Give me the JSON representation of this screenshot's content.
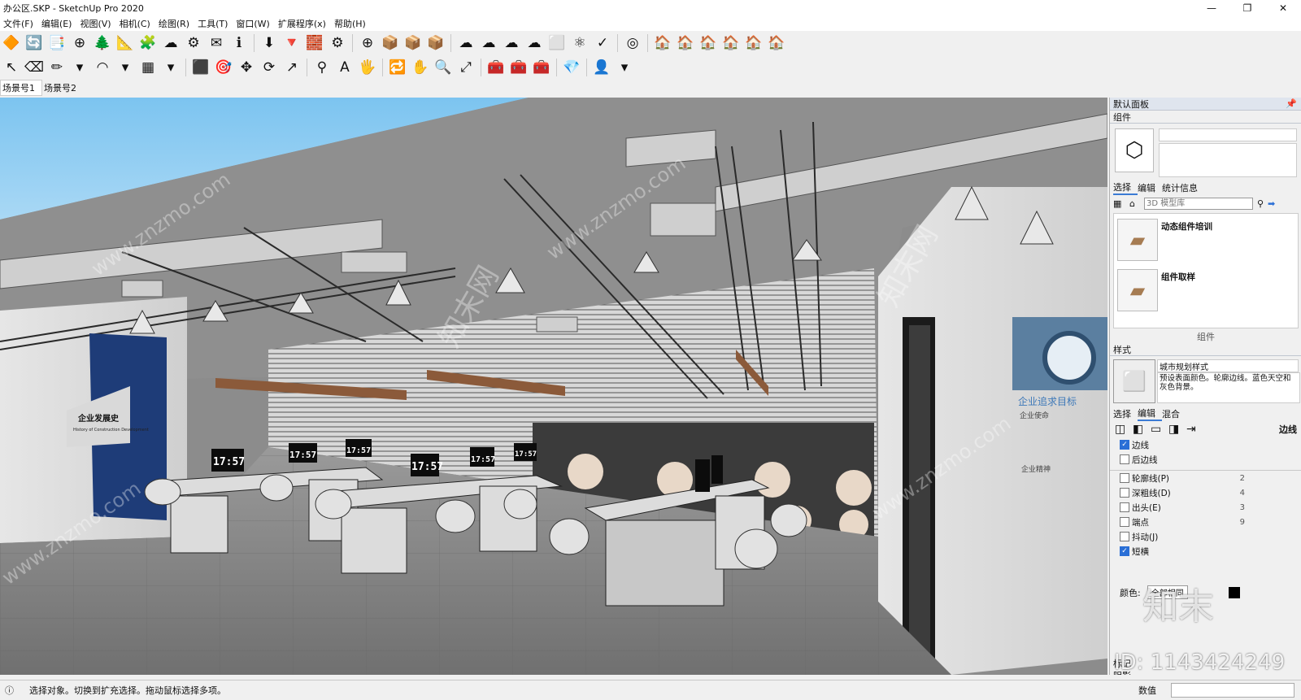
{
  "window": {
    "title": "办公区.SKP - SketchUp Pro 2020",
    "minimize": "—",
    "maximize": "❐",
    "close": "✕"
  },
  "menu": [
    "文件(F)",
    "编辑(E)",
    "视图(V)",
    "相机(C)",
    "绘图(R)",
    "工具(T)",
    "窗口(W)",
    "扩展程序(x)",
    "帮助(H)"
  ],
  "toolbar1": [
    "🔶",
    "🔄",
    "📑",
    "⊕",
    "🌲",
    "📐",
    "🧩",
    "☁",
    "⚙",
    "✉",
    "ℹ",
    "|",
    "⬇",
    "🔻",
    "🧱",
    "⚙",
    "|",
    "⊕",
    "📦",
    "📦",
    "📦",
    "|",
    "☁",
    "☁",
    "☁",
    "☁",
    "⬜",
    "⚛",
    "✓",
    "|",
    "◎",
    "|",
    "🏠",
    "🏠",
    "🏠",
    "🏠",
    "🏠",
    "🏠"
  ],
  "toolbar2": [
    "↖",
    "⌫",
    "✏",
    "▾",
    "◠",
    "▾",
    "▦",
    "▾",
    "|",
    "⬛",
    "🎯",
    "✥",
    "⟳",
    "↗",
    "|",
    "⚲",
    "A",
    "🖐",
    "|",
    "🔁",
    "✋",
    "🔍",
    "⤢",
    "|",
    "🧰",
    "🧰",
    "🧰",
    "|",
    "💎",
    "|",
    "👤",
    "▾"
  ],
  "scenes": [
    "场景号1",
    "场景号2"
  ],
  "viewport": {
    "sign_title": "企业发展史",
    "sign_subtitle": "History of Construction Development",
    "clock": "17:57",
    "right_wall_title": "企业追求目标",
    "right_wall_mission": "企业使命",
    "right_wall_spirit": "企业精神",
    "watermark": "www.znzmo.com",
    "watermark_cn": "知末网",
    "logo": "知末",
    "id_text": "ID: 1143424249"
  },
  "panel": {
    "title": "默认面板",
    "components_header": "组件",
    "comp_tabs": [
      "选择",
      "编辑",
      "统计信息"
    ],
    "search_placeholder": "3D 模型库",
    "items": [
      {
        "name": "动态组件培训"
      },
      {
        "name": "组件取样"
      }
    ],
    "components_footer": "组件",
    "styles_header": "样式",
    "style_name": "城市规划样式",
    "style_desc": "预设表面颜色。轮廓边线。蓝色天空和灰色背景。",
    "style_tabs": [
      "选择",
      "编辑",
      "混合"
    ],
    "edge_label": "边线",
    "edges": [
      {
        "label": "边线",
        "checked": true,
        "value": ""
      },
      {
        "label": "后边线",
        "checked": false,
        "value": ""
      },
      {
        "label": "轮廓线(P)",
        "checked": false,
        "value": "2"
      },
      {
        "label": "深粗线(D)",
        "checked": false,
        "value": "4"
      },
      {
        "label": "出头(E)",
        "checked": false,
        "value": "3"
      },
      {
        "label": "端点",
        "checked": false,
        "value": "9"
      },
      {
        "label": "抖动(J)",
        "checked": false,
        "value": ""
      },
      {
        "label": "短横",
        "checked": true,
        "value": ""
      }
    ],
    "color_label": "颜色:",
    "color_value": "全部相同",
    "tags_header": "标记",
    "shadows_header": "阴影"
  },
  "status": {
    "text": "选择对象。切换到扩充选择。拖动鼠标选择多项。",
    "measure_label": "数值"
  }
}
